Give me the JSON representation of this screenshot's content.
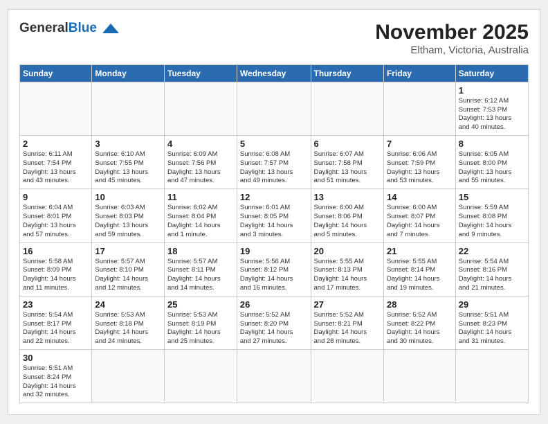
{
  "header": {
    "logo_general": "General",
    "logo_blue": "Blue",
    "month_title": "November 2025",
    "location": "Eltham, Victoria, Australia"
  },
  "days_of_week": [
    "Sunday",
    "Monday",
    "Tuesday",
    "Wednesday",
    "Thursday",
    "Friday",
    "Saturday"
  ],
  "weeks": [
    [
      {
        "day": "",
        "info": ""
      },
      {
        "day": "",
        "info": ""
      },
      {
        "day": "",
        "info": ""
      },
      {
        "day": "",
        "info": ""
      },
      {
        "day": "",
        "info": ""
      },
      {
        "day": "",
        "info": ""
      },
      {
        "day": "1",
        "info": "Sunrise: 6:12 AM\nSunset: 7:53 PM\nDaylight: 13 hours\nand 40 minutes."
      }
    ],
    [
      {
        "day": "2",
        "info": "Sunrise: 6:11 AM\nSunset: 7:54 PM\nDaylight: 13 hours\nand 43 minutes."
      },
      {
        "day": "3",
        "info": "Sunrise: 6:10 AM\nSunset: 7:55 PM\nDaylight: 13 hours\nand 45 minutes."
      },
      {
        "day": "4",
        "info": "Sunrise: 6:09 AM\nSunset: 7:56 PM\nDaylight: 13 hours\nand 47 minutes."
      },
      {
        "day": "5",
        "info": "Sunrise: 6:08 AM\nSunset: 7:57 PM\nDaylight: 13 hours\nand 49 minutes."
      },
      {
        "day": "6",
        "info": "Sunrise: 6:07 AM\nSunset: 7:58 PM\nDaylight: 13 hours\nand 51 minutes."
      },
      {
        "day": "7",
        "info": "Sunrise: 6:06 AM\nSunset: 7:59 PM\nDaylight: 13 hours\nand 53 minutes."
      },
      {
        "day": "8",
        "info": "Sunrise: 6:05 AM\nSunset: 8:00 PM\nDaylight: 13 hours\nand 55 minutes."
      }
    ],
    [
      {
        "day": "9",
        "info": "Sunrise: 6:04 AM\nSunset: 8:01 PM\nDaylight: 13 hours\nand 57 minutes."
      },
      {
        "day": "10",
        "info": "Sunrise: 6:03 AM\nSunset: 8:03 PM\nDaylight: 13 hours\nand 59 minutes."
      },
      {
        "day": "11",
        "info": "Sunrise: 6:02 AM\nSunset: 8:04 PM\nDaylight: 14 hours\nand 1 minute."
      },
      {
        "day": "12",
        "info": "Sunrise: 6:01 AM\nSunset: 8:05 PM\nDaylight: 14 hours\nand 3 minutes."
      },
      {
        "day": "13",
        "info": "Sunrise: 6:00 AM\nSunset: 8:06 PM\nDaylight: 14 hours\nand 5 minutes."
      },
      {
        "day": "14",
        "info": "Sunrise: 6:00 AM\nSunset: 8:07 PM\nDaylight: 14 hours\nand 7 minutes."
      },
      {
        "day": "15",
        "info": "Sunrise: 5:59 AM\nSunset: 8:08 PM\nDaylight: 14 hours\nand 9 minutes."
      }
    ],
    [
      {
        "day": "16",
        "info": "Sunrise: 5:58 AM\nSunset: 8:09 PM\nDaylight: 14 hours\nand 11 minutes."
      },
      {
        "day": "17",
        "info": "Sunrise: 5:57 AM\nSunset: 8:10 PM\nDaylight: 14 hours\nand 12 minutes."
      },
      {
        "day": "18",
        "info": "Sunrise: 5:57 AM\nSunset: 8:11 PM\nDaylight: 14 hours\nand 14 minutes."
      },
      {
        "day": "19",
        "info": "Sunrise: 5:56 AM\nSunset: 8:12 PM\nDaylight: 14 hours\nand 16 minutes."
      },
      {
        "day": "20",
        "info": "Sunrise: 5:55 AM\nSunset: 8:13 PM\nDaylight: 14 hours\nand 17 minutes."
      },
      {
        "day": "21",
        "info": "Sunrise: 5:55 AM\nSunset: 8:14 PM\nDaylight: 14 hours\nand 19 minutes."
      },
      {
        "day": "22",
        "info": "Sunrise: 5:54 AM\nSunset: 8:16 PM\nDaylight: 14 hours\nand 21 minutes."
      }
    ],
    [
      {
        "day": "23",
        "info": "Sunrise: 5:54 AM\nSunset: 8:17 PM\nDaylight: 14 hours\nand 22 minutes."
      },
      {
        "day": "24",
        "info": "Sunrise: 5:53 AM\nSunset: 8:18 PM\nDaylight: 14 hours\nand 24 minutes."
      },
      {
        "day": "25",
        "info": "Sunrise: 5:53 AM\nSunset: 8:19 PM\nDaylight: 14 hours\nand 25 minutes."
      },
      {
        "day": "26",
        "info": "Sunrise: 5:52 AM\nSunset: 8:20 PM\nDaylight: 14 hours\nand 27 minutes."
      },
      {
        "day": "27",
        "info": "Sunrise: 5:52 AM\nSunset: 8:21 PM\nDaylight: 14 hours\nand 28 minutes."
      },
      {
        "day": "28",
        "info": "Sunrise: 5:52 AM\nSunset: 8:22 PM\nDaylight: 14 hours\nand 30 minutes."
      },
      {
        "day": "29",
        "info": "Sunrise: 5:51 AM\nSunset: 8:23 PM\nDaylight: 14 hours\nand 31 minutes."
      }
    ],
    [
      {
        "day": "30",
        "info": "Sunrise: 5:51 AM\nSunset: 8:24 PM\nDaylight: 14 hours\nand 32 minutes."
      },
      {
        "day": "",
        "info": ""
      },
      {
        "day": "",
        "info": ""
      },
      {
        "day": "",
        "info": ""
      },
      {
        "day": "",
        "info": ""
      },
      {
        "day": "",
        "info": ""
      },
      {
        "day": "",
        "info": ""
      }
    ]
  ]
}
